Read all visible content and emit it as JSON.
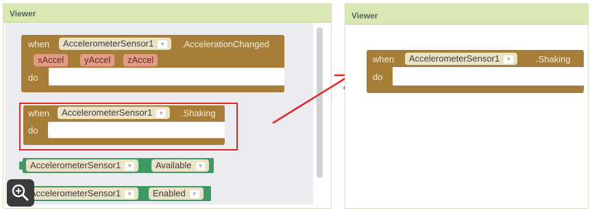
{
  "left_panel": {
    "title": "Viewer",
    "acceleration_block": {
      "when": "when",
      "component": "AccelerometerSensor1",
      "event": ".AccelerationChanged",
      "params": [
        "xAccel",
        "yAccel",
        "zAccel"
      ],
      "do": "do"
    },
    "shaking_block": {
      "when": "when",
      "component": "AccelerometerSensor1",
      "event": ".Shaking",
      "do": "do"
    },
    "available_block": {
      "component": "AccelerometerSensor1",
      "property": "Available"
    },
    "enabled_block": {
      "component": "AccelerometerSensor1",
      "property": "Enabled"
    }
  },
  "right_panel": {
    "title": "Viewer",
    "shaking_block": {
      "when": "when",
      "component": "AccelerometerSensor1",
      "event": ".Shaking",
      "do": "do"
    }
  },
  "colors": {
    "event_block": "#a67e38",
    "property_block": "#3f9866",
    "param": "#e39b86",
    "highlight": "#e52424",
    "header": "#d9e8b3"
  },
  "icons": {
    "zoom": "zoom-in-icon",
    "arrow": "red-arrow-icon",
    "dropdown": "chevron-down-icon"
  }
}
